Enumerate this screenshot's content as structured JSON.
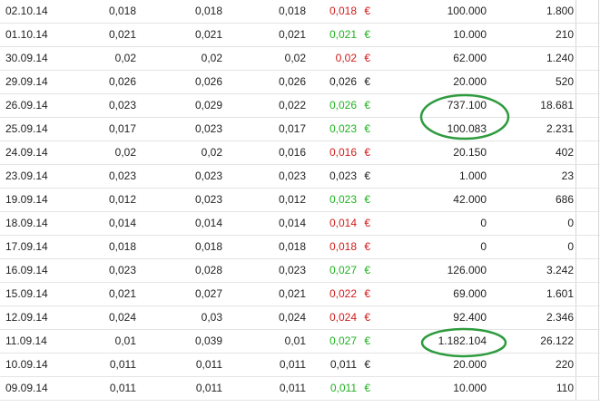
{
  "currency_symbol": "€",
  "colors": {
    "up": "#1fb21f",
    "down": "#d11b1b",
    "flat": "#222222",
    "circle": "#2e9b3e"
  },
  "rows": [
    {
      "date": "02.10.14",
      "c1": "0,018",
      "c2": "0,018",
      "c3": "0,018",
      "c4": "0,018",
      "dir": "down",
      "volume": "100.000",
      "value": "1.800"
    },
    {
      "date": "01.10.14",
      "c1": "0,021",
      "c2": "0,021",
      "c3": "0,021",
      "c4": "0,021",
      "dir": "up",
      "volume": "10.000",
      "value": "210"
    },
    {
      "date": "30.09.14",
      "c1": "0,02",
      "c2": "0,02",
      "c3": "0,02",
      "c4": "0,02",
      "dir": "down",
      "volume": "62.000",
      "value": "1.240"
    },
    {
      "date": "29.09.14",
      "c1": "0,026",
      "c2": "0,026",
      "c3": "0,026",
      "c4": "0,026",
      "dir": "flat",
      "volume": "20.000",
      "value": "520"
    },
    {
      "date": "26.09.14",
      "c1": "0,023",
      "c2": "0,029",
      "c3": "0,022",
      "c4": "0,026",
      "dir": "up",
      "volume": "737.100",
      "value": "18.681"
    },
    {
      "date": "25.09.14",
      "c1": "0,017",
      "c2": "0,023",
      "c3": "0,017",
      "c4": "0,023",
      "dir": "up",
      "volume": "100.083",
      "value": "2.231"
    },
    {
      "date": "24.09.14",
      "c1": "0,02",
      "c2": "0,02",
      "c3": "0,016",
      "c4": "0,016",
      "dir": "down",
      "volume": "20.150",
      "value": "402"
    },
    {
      "date": "23.09.14",
      "c1": "0,023",
      "c2": "0,023",
      "c3": "0,023",
      "c4": "0,023",
      "dir": "flat",
      "volume": "1.000",
      "value": "23"
    },
    {
      "date": "19.09.14",
      "c1": "0,012",
      "c2": "0,023",
      "c3": "0,012",
      "c4": "0,023",
      "dir": "up",
      "volume": "42.000",
      "value": "686"
    },
    {
      "date": "18.09.14",
      "c1": "0,014",
      "c2": "0,014",
      "c3": "0,014",
      "c4": "0,014",
      "dir": "down",
      "volume": "0",
      "value": "0"
    },
    {
      "date": "17.09.14",
      "c1": "0,018",
      "c2": "0,018",
      "c3": "0,018",
      "c4": "0,018",
      "dir": "down",
      "volume": "0",
      "value": "0"
    },
    {
      "date": "16.09.14",
      "c1": "0,023",
      "c2": "0,028",
      "c3": "0,023",
      "c4": "0,027",
      "dir": "up",
      "volume": "126.000",
      "value": "3.242"
    },
    {
      "date": "15.09.14",
      "c1": "0,021",
      "c2": "0,027",
      "c3": "0,021",
      "c4": "0,022",
      "dir": "down",
      "volume": "69.000",
      "value": "1.601"
    },
    {
      "date": "12.09.14",
      "c1": "0,024",
      "c2": "0,03",
      "c3": "0,024",
      "c4": "0,024",
      "dir": "down",
      "volume": "92.400",
      "value": "2.346"
    },
    {
      "date": "11.09.14",
      "c1": "0,01",
      "c2": "0,039",
      "c3": "0,01",
      "c4": "0,027",
      "dir": "up",
      "volume": "1.182.104",
      "value": "26.122"
    },
    {
      "date": "10.09.14",
      "c1": "0,011",
      "c2": "0,011",
      "c3": "0,011",
      "c4": "0,011",
      "dir": "flat",
      "volume": "20.000",
      "value": "220"
    },
    {
      "date": "09.09.14",
      "c1": "0,011",
      "c2": "0,011",
      "c3": "0,011",
      "c4": "0,011",
      "dir": "up",
      "volume": "10.000",
      "value": "110"
    }
  ]
}
